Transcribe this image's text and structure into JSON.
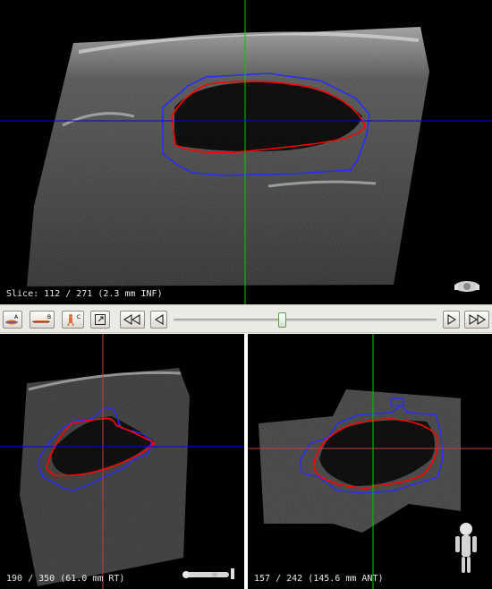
{
  "views": {
    "axial": {
      "slice_label": "Slice: 112 / 271 (2.3 mm INF)",
      "orientation_icon": "axial-figure-icon"
    },
    "sagittal": {
      "slice_label": "190 / 350 (61.0 mm RT)",
      "orientation_icon": "sagittal-figure-icon"
    },
    "coronal": {
      "slice_label": "157 / 242 (145.6 mm ANT)",
      "orientation_icon": "coronal-figure-icon"
    }
  },
  "toolbar": {
    "buttons": [
      {
        "name": "view-a-button",
        "letter": "A",
        "icon": "axial-view-icon"
      },
      {
        "name": "view-b-button",
        "letter": "B",
        "icon": "sagittal-view-icon"
      },
      {
        "name": "view-c-button",
        "letter": "C",
        "icon": "coronal-view-icon"
      },
      {
        "name": "maximize-view-button",
        "icon": "maximize-icon"
      },
      {
        "name": "fast-back-button",
        "icon": "double-left-arrow-icon"
      },
      {
        "name": "step-back-button",
        "icon": "left-arrow-icon"
      },
      {
        "name": "step-forward-button",
        "icon": "right-arrow-icon"
      },
      {
        "name": "fast-forward-button",
        "icon": "double-right-arrow-icon"
      }
    ],
    "slice_slider_position": 0.41
  },
  "colors": {
    "crosshair_vertical": "#00cc00",
    "crosshair_horizontal": "#0000ff",
    "crosshair_horizontal_alt": "#c04040",
    "segmentation_outline": "#ff0000",
    "region_outline": "#2a2aff"
  }
}
